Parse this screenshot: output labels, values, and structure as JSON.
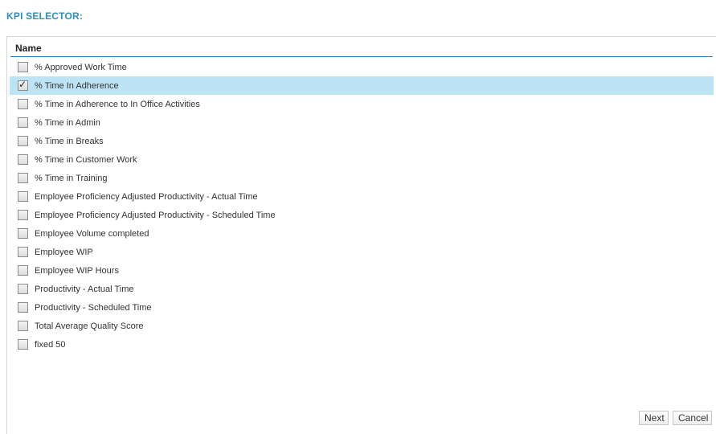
{
  "page": {
    "title": "KPI SELECTOR:"
  },
  "list": {
    "header": "Name",
    "items": [
      {
        "label": "% Approved Work Time",
        "checked": false
      },
      {
        "label": "% Time In Adherence",
        "checked": true
      },
      {
        "label": "% Time in Adherence to In Office Activities",
        "checked": false
      },
      {
        "label": "% Time in Admin",
        "checked": false
      },
      {
        "label": "% Time in Breaks",
        "checked": false
      },
      {
        "label": "% Time in Customer Work",
        "checked": false
      },
      {
        "label": "% Time in Training",
        "checked": false
      },
      {
        "label": "Employee Proficiency Adjusted Productivity - Actual Time",
        "checked": false
      },
      {
        "label": "Employee Proficiency Adjusted Productivity - Scheduled Time",
        "checked": false
      },
      {
        "label": "Employee Volume completed",
        "checked": false
      },
      {
        "label": "Employee WIP",
        "checked": false
      },
      {
        "label": "Employee WIP Hours",
        "checked": false
      },
      {
        "label": "Productivity - Actual Time",
        "checked": false
      },
      {
        "label": "Productivity - Scheduled Time",
        "checked": false
      },
      {
        "label": "Total Average Quality Score",
        "checked": false
      },
      {
        "label": "fixed 50",
        "checked": false
      }
    ]
  },
  "buttons": {
    "next_label": "Next",
    "cancel_label": "Cancel"
  },
  "colors": {
    "title": "#2a8fc1",
    "selected_row": "#bde4f4",
    "header_rule": "#2a7fa8"
  }
}
